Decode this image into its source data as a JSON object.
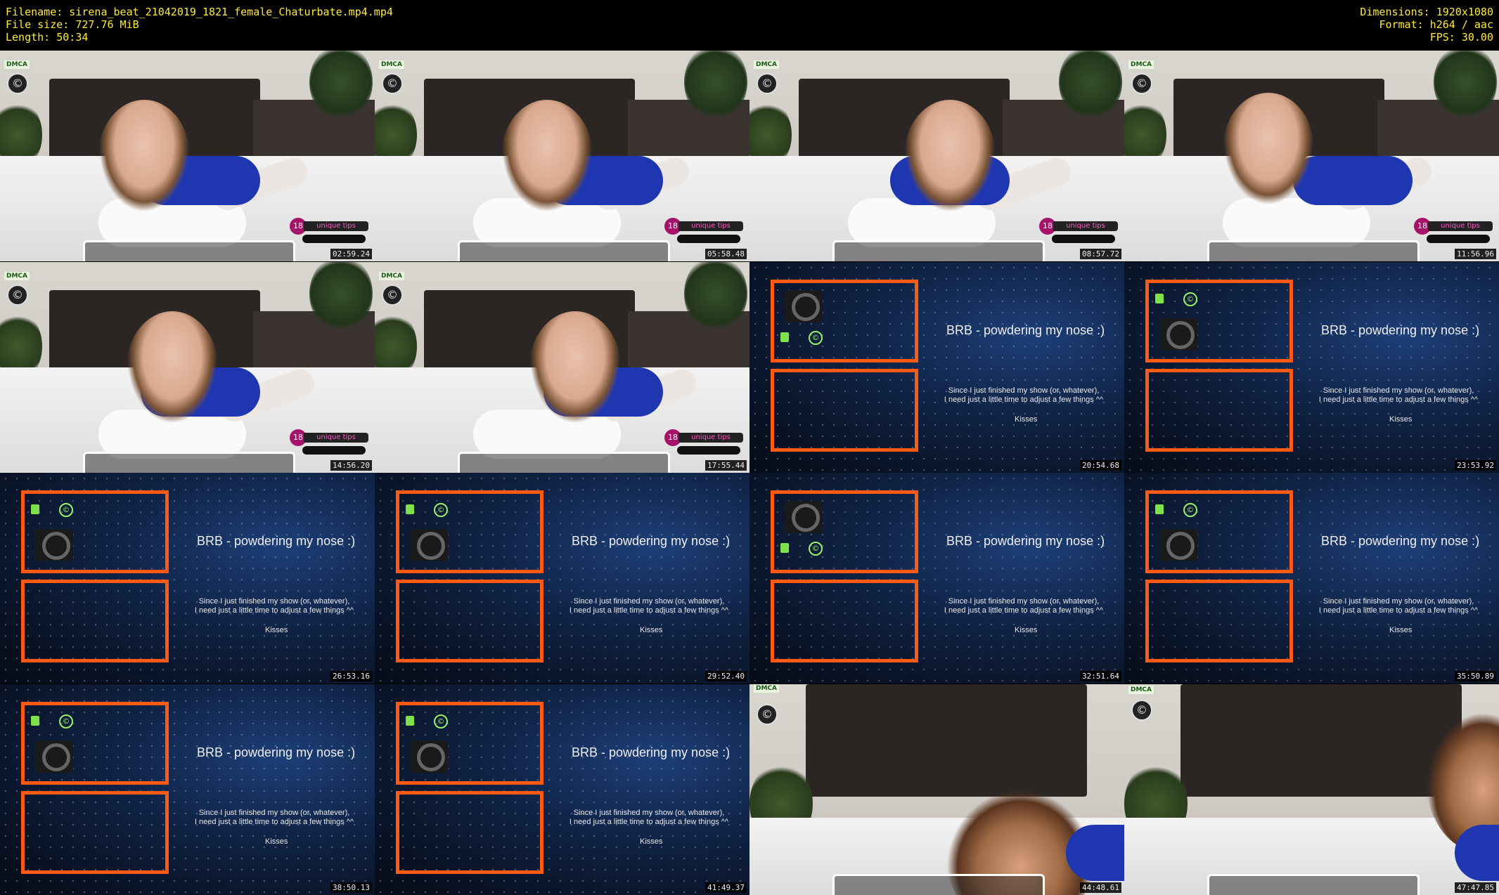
{
  "header": {
    "filename": "Filename: sirena_beat_21042019_1821_female_Chaturbate.mp4.mp4",
    "filesize": "File size: 727.76 MiB",
    "length": "Length: 50:34",
    "dimensions": "Dimensions: 1920x1080",
    "format": "Format: h264 / aac",
    "fps": "FPS: 30.00"
  },
  "overlay": {
    "dmca": "DMCA",
    "copyright": "©",
    "badge": "18",
    "tips": "unique tips"
  },
  "brb": {
    "title": "BRB - powdering my nose :)",
    "line1": "Since I just finished my show (or, whatever),",
    "line2": "I need just a little time to adjust a few things ^^",
    "kisses": "Kisses"
  },
  "thumbs": [
    {
      "type": "room",
      "time": "02:59.24"
    },
    {
      "type": "room",
      "time": "05:58.48"
    },
    {
      "type": "room",
      "time": "08:57.72"
    },
    {
      "type": "room",
      "time": "11:56.96"
    },
    {
      "type": "room",
      "time": "14:56.20"
    },
    {
      "type": "room",
      "time": "17:55.44"
    },
    {
      "type": "brb",
      "time": "20:54.68"
    },
    {
      "type": "brb",
      "time": "23:53.92"
    },
    {
      "type": "brb",
      "time": "26:53.16"
    },
    {
      "type": "brb",
      "time": "29:52.40"
    },
    {
      "type": "brb",
      "time": "32:51.64"
    },
    {
      "type": "brb",
      "time": "35:50.89"
    },
    {
      "type": "brb",
      "time": "38:50.13"
    },
    {
      "type": "brb",
      "time": "41:49.37"
    },
    {
      "type": "close",
      "time": "44:48.61"
    },
    {
      "type": "close",
      "time": "47:47.85"
    }
  ]
}
